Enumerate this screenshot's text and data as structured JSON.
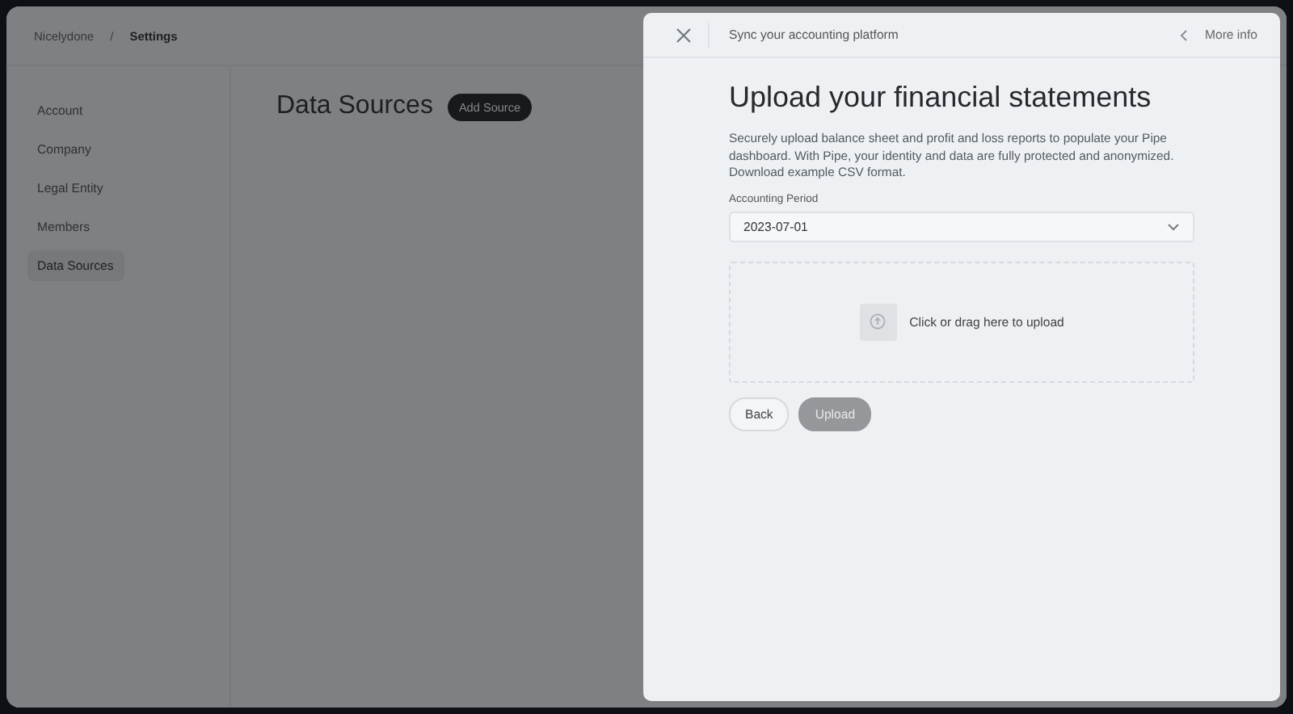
{
  "breadcrumb": {
    "items": [
      "Nicelydone",
      "Settings"
    ],
    "separator": "/"
  },
  "sidebar": {
    "items": [
      {
        "label": "Account",
        "selected": false
      },
      {
        "label": "Company",
        "selected": false
      },
      {
        "label": "Legal Entity",
        "selected": false
      },
      {
        "label": "Members",
        "selected": false
      },
      {
        "label": "Data Sources",
        "selected": true
      }
    ]
  },
  "page": {
    "title": "Data Sources",
    "add_button": "Add Source"
  },
  "panel": {
    "title": "Sync your accounting platform",
    "more_info": "More info",
    "heading": "Upload your financial statements",
    "description": "Securely upload balance sheet and profit and loss reports to populate your Pipe dashboard. With Pipe, your identity and data are fully protected and anonymized. Download example CSV format.",
    "field": {
      "label": "Accounting Period",
      "value": "2023-07-01"
    },
    "dropzone": "Click or drag here to upload",
    "buttons": [
      {
        "label": "Back",
        "disabled": false
      },
      {
        "label": "Upload",
        "disabled": true
      }
    ]
  }
}
